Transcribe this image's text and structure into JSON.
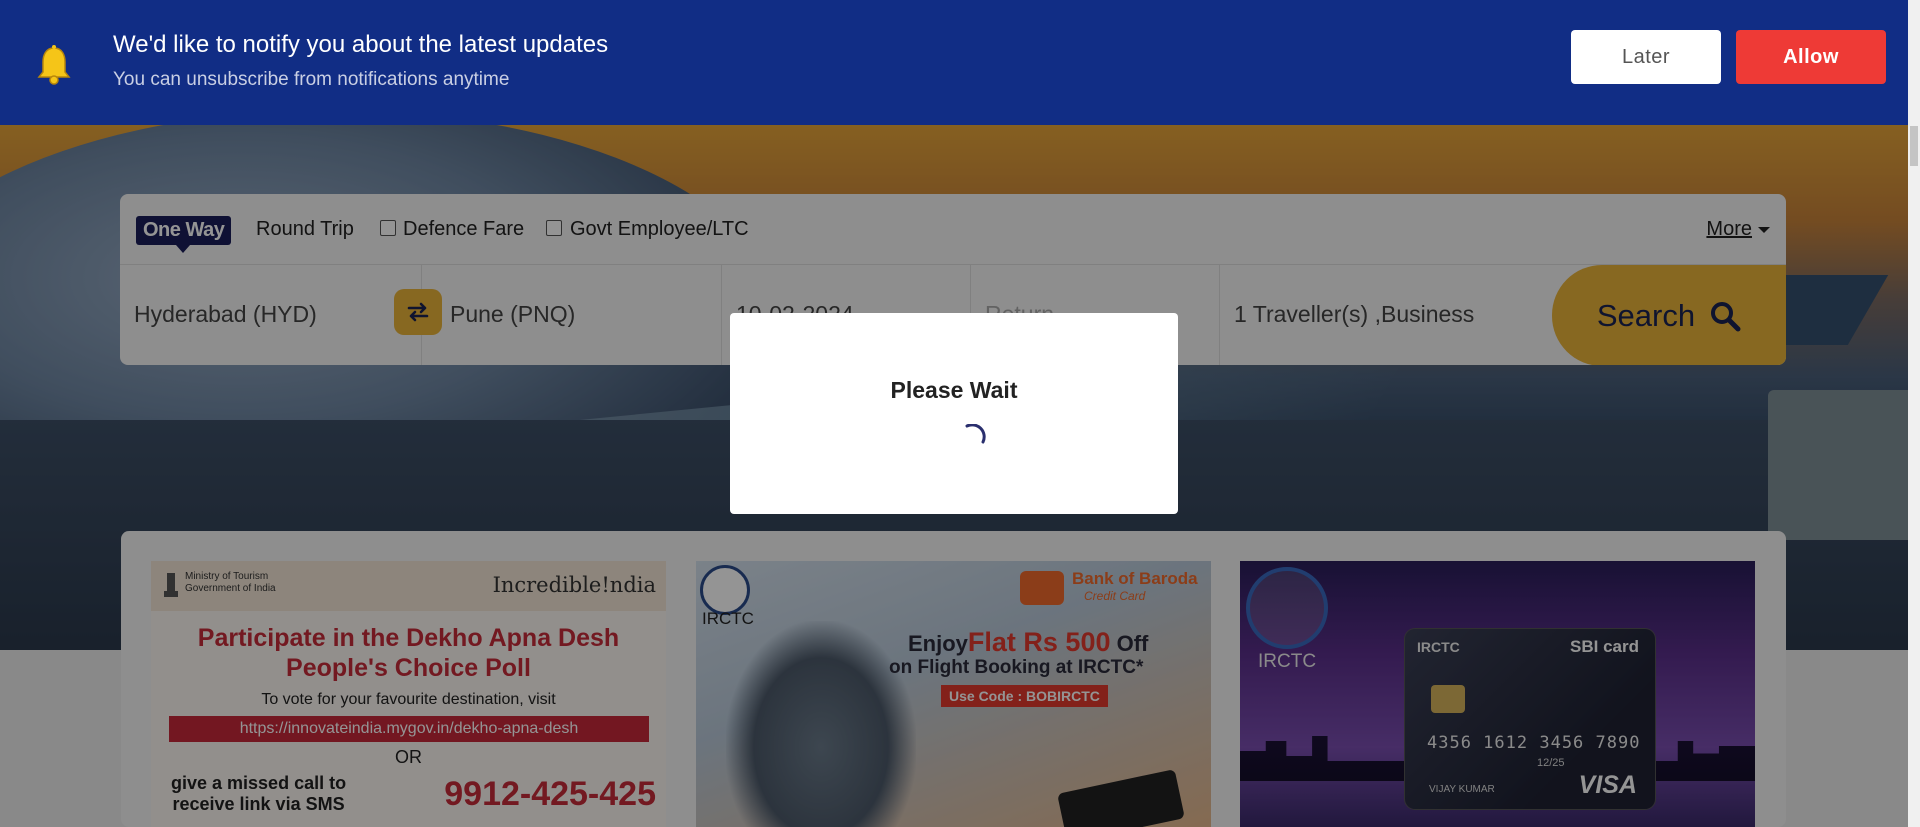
{
  "notification": {
    "title": "We'd like to notify you about the latest updates",
    "subtitle": "You can unsubscribe from notifications anytime",
    "later_label": "Later",
    "allow_label": "Allow",
    "icon": "bell-icon"
  },
  "search": {
    "trip_types": {
      "one_way": "One Way",
      "round_trip": "Round Trip"
    },
    "options": {
      "defence_fare": "Defence Fare",
      "govt_employee": "Govt Employee/LTC"
    },
    "more_label": "More",
    "from": "Hyderabad (HYD)",
    "to": "Pune (PNQ)",
    "depart_date": "10-02-2024",
    "return_placeholder": "Return",
    "travellers": "1  Traveller(s) ,Business",
    "search_label": "Search"
  },
  "modal": {
    "title": "Please Wait"
  },
  "offers": [
    {
      "ministry": "Ministry of Tourism",
      "government": "Government of India",
      "brand": "Incredible!ndia",
      "headline_1": "Participate in the Dekho Apna Desh",
      "headline_2": "People's Choice Poll",
      "vote_text": "To vote for your favourite destination, visit",
      "url": "https://innovateindia.mygov.in/dekho-apna-desh",
      "or": "OR",
      "call_text_1": "give a missed call to",
      "call_text_2": "receive link via SMS",
      "phone": "9912-425-425"
    },
    {
      "irctc": "IRCTC",
      "bank": "Bank of Baroda",
      "bank_sub": "Credit Card",
      "enjoy": "Enjoy",
      "flat": "Flat Rs 500",
      "off": "Off",
      "on_booking": "on Flight Booking at IRCTC*",
      "code": "Use Code : BOBIRCTC"
    },
    {
      "irctc": "IRCTC",
      "card_brand": "IRCTC",
      "sbi": "SBI card",
      "card_number": "4356 1612 3456 7890",
      "expiry": "12/25",
      "holder": "VIJAY KUMAR",
      "network": "VISA"
    }
  ],
  "colors": {
    "notify_bg": "#112d85",
    "allow_btn": "#ee3a36",
    "search_accent": "#e8b33a",
    "one_way_badge": "#1a1e5a"
  }
}
